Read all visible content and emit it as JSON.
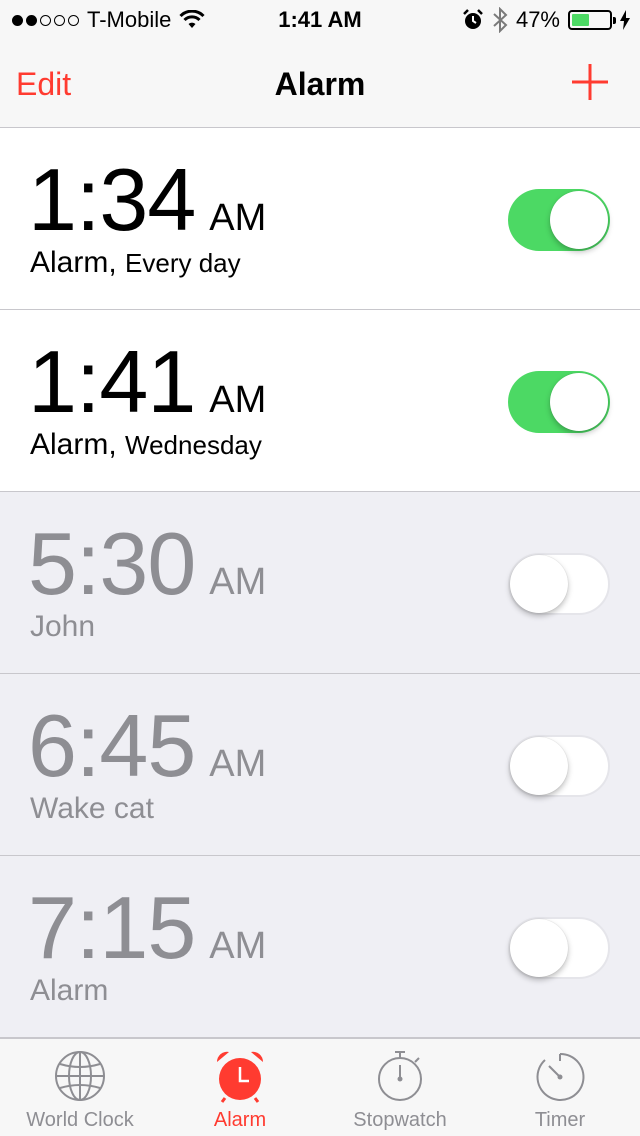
{
  "status_bar": {
    "carrier": "T-Mobile",
    "time": "1:41 AM",
    "battery": "47%",
    "battery_level": 0.47,
    "signal_bars": 2
  },
  "nav": {
    "edit_label": "Edit",
    "title": "Alarm"
  },
  "alarms": [
    {
      "time": "1:34",
      "ampm": "AM",
      "label": "Alarm,",
      "repeat": "Every day",
      "enabled": true
    },
    {
      "time": "1:41",
      "ampm": "AM",
      "label": "Alarm,",
      "repeat": "Wednesday",
      "enabled": true
    },
    {
      "time": "5:30",
      "ampm": "AM",
      "label": "John",
      "repeat": "",
      "enabled": false
    },
    {
      "time": "6:45",
      "ampm": "AM",
      "label": "Wake cat",
      "repeat": "",
      "enabled": false
    },
    {
      "time": "7:15",
      "ampm": "AM",
      "label": "Alarm",
      "repeat": "",
      "enabled": false
    }
  ],
  "tabs": [
    {
      "label": "World Clock",
      "icon": "globe-icon",
      "active": false
    },
    {
      "label": "Alarm",
      "icon": "alarm-clock-icon",
      "active": true
    },
    {
      "label": "Stopwatch",
      "icon": "stopwatch-icon",
      "active": false
    },
    {
      "label": "Timer",
      "icon": "timer-icon",
      "active": false
    }
  ],
  "colors": {
    "accent": "#ff3b30",
    "toggle_on": "#4cd964",
    "inactive": "#8e8e93",
    "battery": "#4cd964"
  }
}
